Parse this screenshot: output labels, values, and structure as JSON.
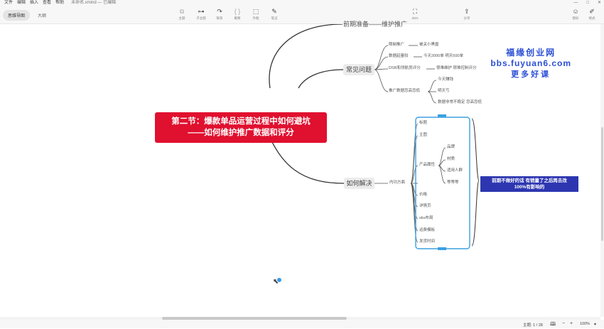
{
  "menu": [
    "文件",
    "编辑",
    "插入",
    "查看",
    "帮助"
  ],
  "window_title": "未命名.xmind — 已编辑",
  "window_controls": [
    "—",
    "□",
    "✕"
  ],
  "view_tabs": [
    "思维导图",
    "大纲"
  ],
  "toolbar": {
    "topic": "主题",
    "subtopic": "子主题",
    "relation": "联系",
    "summary": "概要",
    "boundary": "外框",
    "note": "笔记",
    "zen": "ZEN",
    "share": "分享",
    "icons": "图标",
    "format": "格式"
  },
  "mindmap": {
    "root": [
      "第二节：爆款单品运营过程中如何避坑",
      "——如何维护推广数据和评分"
    ],
    "top_branch": "前期准备——维护推广",
    "branch_common": "常见问题",
    "common_items": [
      {
        "label": "限制推广",
        "child": "被关小黑屋"
      },
      {
        "label": "数据起量较",
        "child": "今天2000单 明天500单"
      },
      {
        "label": "DSR和领航员评分",
        "child": "很难维护 很难控制评分"
      },
      {
        "label": "推广数据忽高忽低",
        "children": [
          "今天赚钱",
          "明天亏",
          "数据非常不稳定 忽高忽低"
        ]
      }
    ],
    "branch_solve": "如何解决",
    "solve_sub": "内功方面",
    "solve_items": [
      "标题",
      "主图",
      "产品属性",
      "价格",
      "详情页",
      "sku布局",
      "运费模板",
      "发货时间"
    ],
    "attr_items": [
      "品牌",
      "材质",
      "适用人群",
      "等等等"
    ],
    "summary": [
      "前期不做好的话 有销量了之后再去改",
      "100%有影响的"
    ]
  },
  "watermark": [
    "福缘创业网",
    "bbs.fuyuan6.com",
    "更多好课"
  ],
  "status": {
    "topic_count": "主题: 1 / 28",
    "zoom": "100%"
  }
}
